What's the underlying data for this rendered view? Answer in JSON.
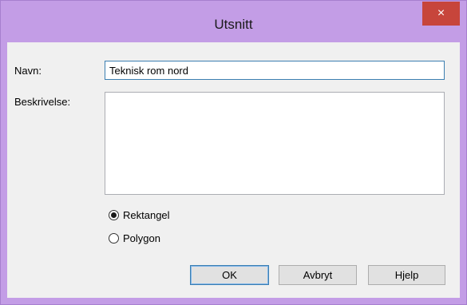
{
  "window": {
    "title": "Utsnitt",
    "close_icon": "×"
  },
  "form": {
    "name_label": "Navn:",
    "name_value": "Teknisk rom nord",
    "description_label": "Beskrivelse:",
    "description_value": ""
  },
  "shape": {
    "options": [
      {
        "label": "Rektangel",
        "checked": true
      },
      {
        "label": "Polygon",
        "checked": false
      }
    ]
  },
  "buttons": {
    "ok": "OK",
    "cancel": "Avbryt",
    "help": "Hjelp"
  },
  "colors": {
    "titlebar": "#c39de6",
    "close_button": "#c7453b",
    "client": "#f0f0f0"
  }
}
